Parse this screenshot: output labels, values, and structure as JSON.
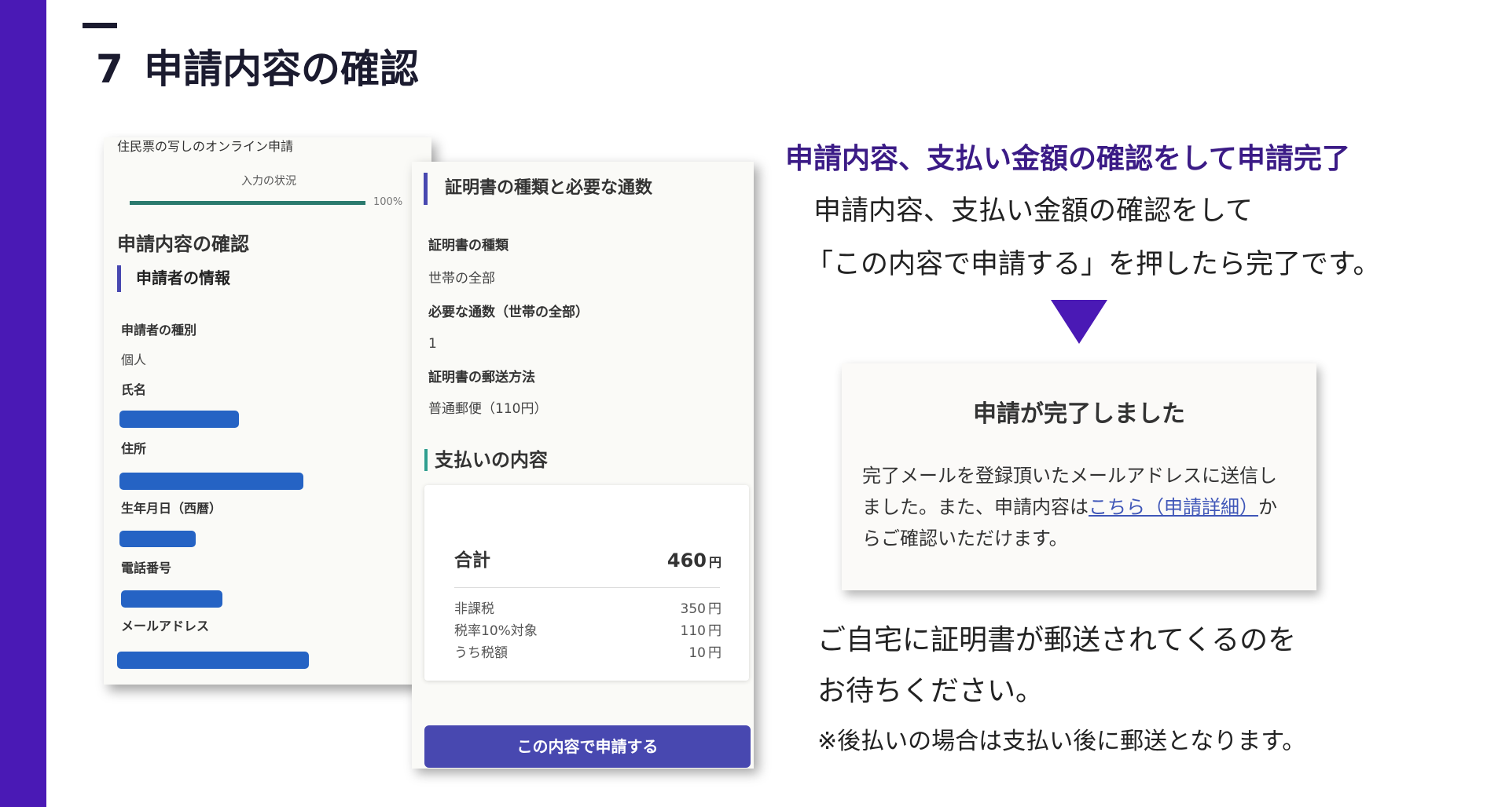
{
  "colors": {
    "accent_purple": "#4a19b5",
    "heading_purple": "#3b1b86",
    "form_blue": "#4848b0",
    "teal": "#2f9e8f",
    "progress": "#2b7a6e",
    "redaction": "#2563c4",
    "link": "#3f56b8",
    "title_ink": "#1b1b2f"
  },
  "slide": {
    "number": "7",
    "title": "申請内容の確認"
  },
  "applicant_panel": {
    "app_title": "住民票の写しのオンライン申請",
    "progress_label": "入力の状況",
    "progress_text": "100%",
    "progress_fraction": 1.0,
    "page_heading": "申請内容の確認",
    "section_heading": "申請者の情報",
    "fields": [
      {
        "label": "申請者の種別",
        "value": "個人"
      },
      {
        "label": "氏名",
        "redacted": true
      },
      {
        "label": "住所",
        "redacted": true
      },
      {
        "label": "生年月日（西暦）",
        "redacted": true
      },
      {
        "label": "電話番号",
        "redacted": true
      },
      {
        "label": "メールアドレス",
        "redacted": true
      }
    ]
  },
  "certificate_panel": {
    "section_heading": "証明書の種類と必要な通数",
    "fields": [
      {
        "label": "証明書の種類",
        "value": "世帯の全部"
      },
      {
        "label": "必要な通数（世帯の全部）",
        "value": "1"
      },
      {
        "label": "証明書の郵送方法",
        "value": "普通郵便（110円）"
      }
    ],
    "payment_heading": "支払いの内容",
    "total_label": "合計",
    "total_amount": "460",
    "currency": "円",
    "breakdown": [
      {
        "label": "非課税",
        "amount": "350",
        "unit": "円"
      },
      {
        "label": "税率10%対象",
        "amount": "110",
        "unit": "円"
      },
      {
        "label": "うち税額",
        "amount": "10",
        "unit": "円"
      }
    ],
    "submit_button": "この内容で申請する"
  },
  "explanation": {
    "headline": "申請内容、支払い金額の確認をして申請完了",
    "lines": [
      "申請内容、支払い金額の確認をして",
      "「この内容で申請する」を押したら完了です。"
    ],
    "arrow_icon": "down-triangle-icon",
    "completion_card": {
      "title": "申請が完了しました",
      "text_before_link": "完了メールを登録頂いたメールアドレスに送信しました。また、申請内容は",
      "link_text": "こちら（申請詳細）",
      "text_after_link": "からご確認いただけます。"
    },
    "closing_lines": [
      "ご自宅に証明書が郵送されてくるのを",
      "お待ちください。"
    ],
    "note": "※後払いの場合は支払い後に郵送となります。"
  }
}
